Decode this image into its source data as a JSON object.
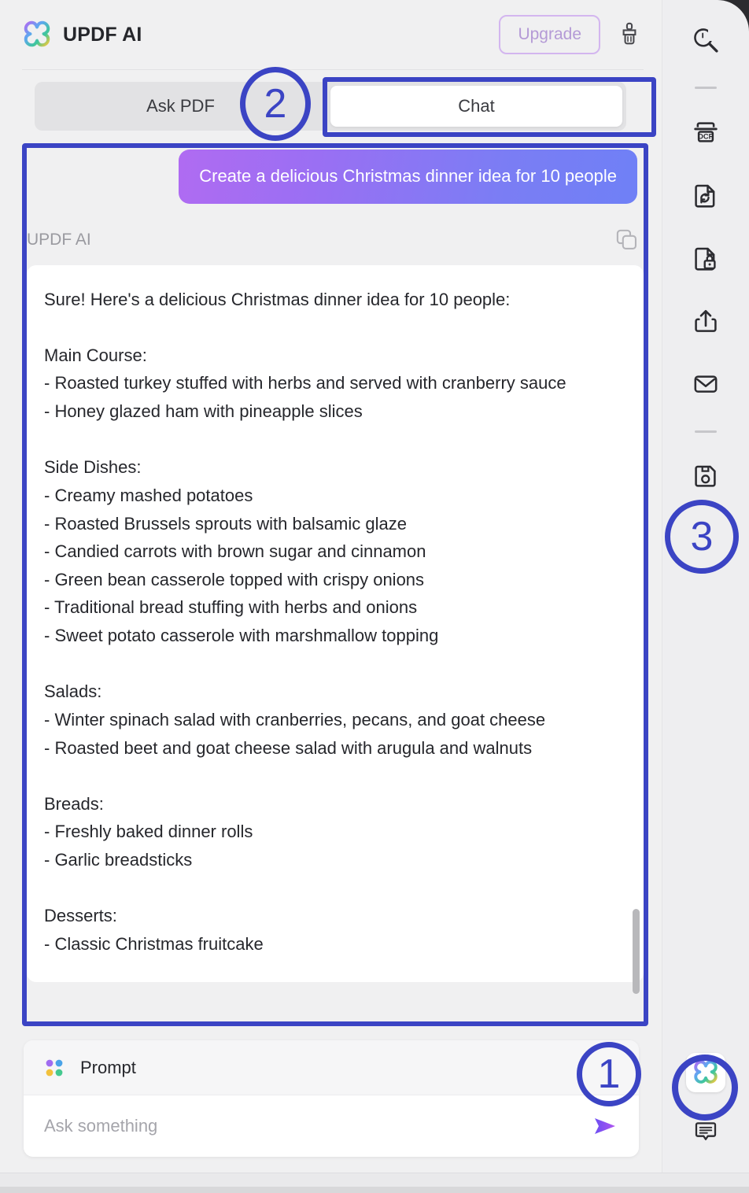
{
  "window": {
    "app_title": "UPDF AI"
  },
  "header": {
    "brand_name": "UPDF AI",
    "logo_icon": "updf-clover-logo",
    "upgrade_label": "Upgrade",
    "brush_icon": "brush-icon"
  },
  "tabs": [
    {
      "label": "Ask PDF",
      "active": false
    },
    {
      "label": "Chat",
      "active": true
    }
  ],
  "chat": {
    "user_message": "Create a delicious Christmas dinner idea for 10 people",
    "ai_label": "UPDF AI",
    "copy_icon": "copy-icon",
    "ai_message": "Sure! Here's a delicious Christmas dinner idea for 10 people:\n\nMain Course:\n- Roasted turkey stuffed with herbs and served with cranberry sauce\n- Honey glazed ham with pineapple slices\n\nSide Dishes:\n- Creamy mashed potatoes\n- Roasted Brussels sprouts with balsamic glaze\n- Candied carrots with brown sugar and cinnamon\n- Green bean casserole topped with crispy onions\n- Traditional bread stuffing with herbs and onions\n- Sweet potato casserole with marshmallow topping\n\nSalads:\n- Winter spinach salad with cranberries, pecans, and goat cheese\n- Roasted beet and goat cheese salad with arugula and walnuts\n\nBreads:\n- Freshly baked dinner rolls\n- Garlic breadsticks\n\nDesserts:\n- Classic Christmas fruitcake"
  },
  "prompt": {
    "icon": "four-dots-icon",
    "title": "Prompt",
    "placeholder": "Ask something",
    "value": "",
    "send_icon": "send-arrow-icon"
  },
  "toolbar": {
    "items": [
      {
        "icon": "search-icon",
        "name": "search"
      },
      {
        "icon": "ocr-icon",
        "name": "ocr"
      },
      {
        "icon": "convert-document-icon",
        "name": "convert"
      },
      {
        "icon": "protect-document-icon",
        "name": "protect"
      },
      {
        "icon": "share-export-icon",
        "name": "share"
      },
      {
        "icon": "email-icon",
        "name": "email"
      },
      {
        "icon": "save-disk-icon",
        "name": "save"
      }
    ],
    "bottom_items": [
      {
        "icon": "updf-ai-logo-icon",
        "name": "updf-ai"
      },
      {
        "icon": "comment-bubble-icon",
        "name": "comment"
      }
    ]
  },
  "annotations": [
    {
      "number": "1",
      "target": "prompt-area"
    },
    {
      "number": "2",
      "target": "chat-tab"
    },
    {
      "number": "3",
      "target": "right-toolbar"
    }
  ],
  "colors": {
    "annotation_blue": "#3b44c4",
    "bubble_gradient_start": "#b06bf2",
    "bubble_gradient_end": "#6f80f6",
    "upgrade_border": "#d3b6ef",
    "upgrade_text": "#b49ad6",
    "send_arrow": "#8a4ff0",
    "panel_bg": "#f0f0f1",
    "toolbar_bg": "#eeeef0"
  }
}
